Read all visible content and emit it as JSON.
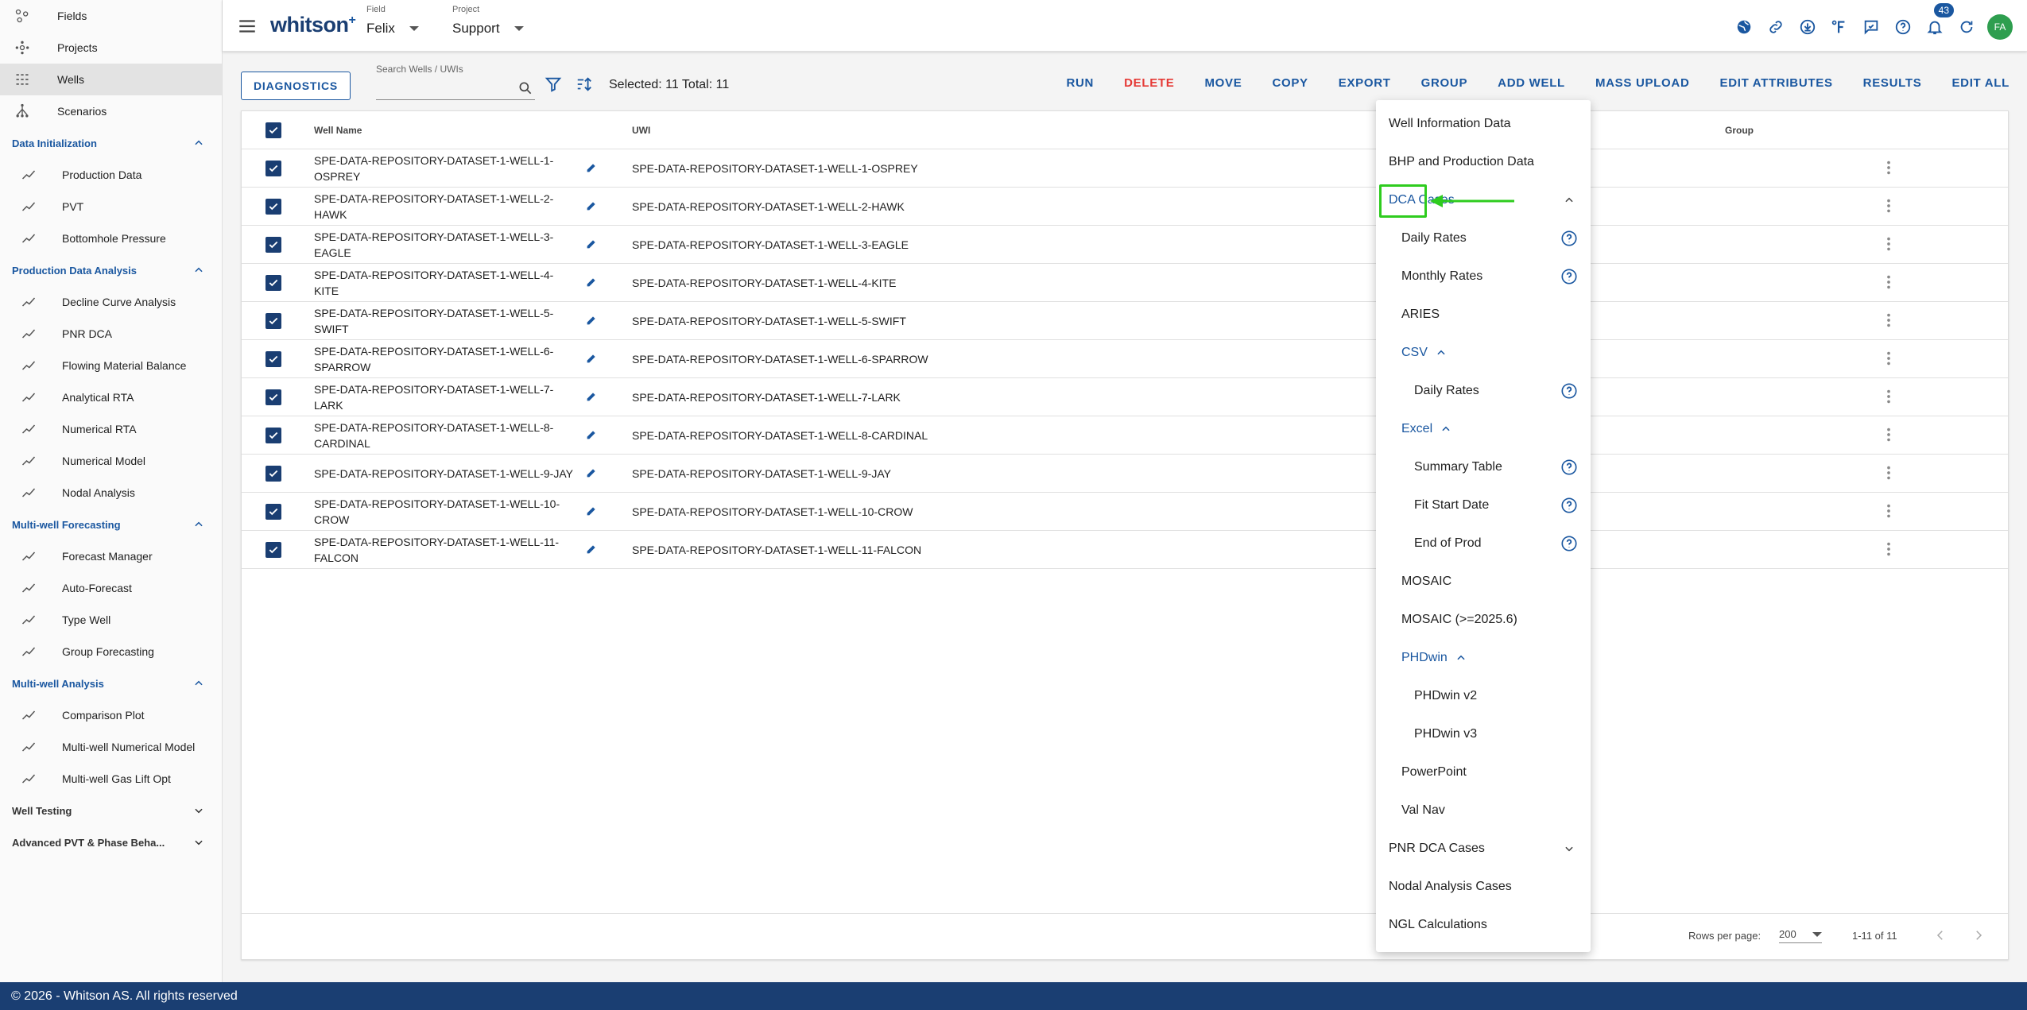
{
  "sidebar": {
    "top_items": [
      {
        "label": "Fields",
        "icon": "fields-icon"
      },
      {
        "label": "Projects",
        "icon": "projects-icon"
      },
      {
        "label": "Wells",
        "icon": "wells-icon"
      },
      {
        "label": "Scenarios",
        "icon": "scenarios-icon"
      }
    ],
    "sections": [
      {
        "title": "Data Initialization",
        "expanded": true,
        "items": [
          "Production Data",
          "PVT",
          "Bottomhole Pressure"
        ]
      },
      {
        "title": "Production Data Analysis",
        "expanded": true,
        "items": [
          "Decline Curve Analysis",
          "PNR DCA",
          "Flowing Material Balance",
          "Analytical RTA",
          "Numerical RTA",
          "Numerical Model",
          "Nodal Analysis"
        ]
      },
      {
        "title": "Multi-well Forecasting",
        "expanded": true,
        "items": [
          "Forecast Manager",
          "Auto-Forecast",
          "Type Well",
          "Group Forecasting"
        ]
      },
      {
        "title": "Multi-well Analysis",
        "expanded": true,
        "items": [
          "Comparison Plot",
          "Multi-well Numerical Model",
          "Multi-well Gas Lift Opt"
        ]
      },
      {
        "title": "Well Testing",
        "expanded": false,
        "items": []
      },
      {
        "title": "Advanced PVT & Phase Beha...",
        "expanded": false,
        "items": []
      }
    ]
  },
  "topbar": {
    "logo": "whitson",
    "logo_plus": "+",
    "field_label": "Field",
    "field_value": "Felix",
    "project_label": "Project",
    "project_value": "Support",
    "notifications_count": "43",
    "avatar_initials": "FA"
  },
  "toolbar": {
    "diagnostics_label": "DIAGNOSTICS",
    "search_placeholder": "Search Wells / UWIs",
    "selected_text": "Selected: 11 Total: 11",
    "actions": [
      "RUN",
      "DELETE",
      "MOVE",
      "COPY",
      "EXPORT",
      "GROUP",
      "ADD WELL",
      "MASS UPLOAD",
      "EDIT ATTRIBUTES",
      "RESULTS",
      "EDIT ALL"
    ]
  },
  "table": {
    "headers": {
      "well_name": "Well Name",
      "uwi": "UWI",
      "group": "Group"
    },
    "rows": [
      {
        "name": "SPE-DATA-REPOSITORY-DATASET-1-WELL-1-OSPREY",
        "uwi": "SPE-DATA-REPOSITORY-DATASET-1-WELL-1-OSPREY"
      },
      {
        "name": "SPE-DATA-REPOSITORY-DATASET-1-WELL-2-HAWK",
        "uwi": "SPE-DATA-REPOSITORY-DATASET-1-WELL-2-HAWK"
      },
      {
        "name": "SPE-DATA-REPOSITORY-DATASET-1-WELL-3-EAGLE",
        "uwi": "SPE-DATA-REPOSITORY-DATASET-1-WELL-3-EAGLE"
      },
      {
        "name": "SPE-DATA-REPOSITORY-DATASET-1-WELL-4-KITE",
        "uwi": "SPE-DATA-REPOSITORY-DATASET-1-WELL-4-KITE"
      },
      {
        "name": "SPE-DATA-REPOSITORY-DATASET-1-WELL-5-SWIFT",
        "uwi": "SPE-DATA-REPOSITORY-DATASET-1-WELL-5-SWIFT"
      },
      {
        "name": "SPE-DATA-REPOSITORY-DATASET-1-WELL-6-SPARROW",
        "uwi": "SPE-DATA-REPOSITORY-DATASET-1-WELL-6-SPARROW"
      },
      {
        "name": "SPE-DATA-REPOSITORY-DATASET-1-WELL-7-LARK",
        "uwi": "SPE-DATA-REPOSITORY-DATASET-1-WELL-7-LARK"
      },
      {
        "name": "SPE-DATA-REPOSITORY-DATASET-1-WELL-8-CARDINAL",
        "uwi": "SPE-DATA-REPOSITORY-DATASET-1-WELL-8-CARDINAL"
      },
      {
        "name": "SPE-DATA-REPOSITORY-DATASET-1-WELL-9-JAY",
        "uwi": "SPE-DATA-REPOSITORY-DATASET-1-WELL-9-JAY"
      },
      {
        "name": "SPE-DATA-REPOSITORY-DATASET-1-WELL-10-CROW",
        "uwi": "SPE-DATA-REPOSITORY-DATASET-1-WELL-10-CROW"
      },
      {
        "name": "SPE-DATA-REPOSITORY-DATASET-1-WELL-11-FALCON",
        "uwi": "SPE-DATA-REPOSITORY-DATASET-1-WELL-11-FALCON"
      }
    ],
    "footer": {
      "rows_per_page_label": "Rows per page:",
      "rows_per_page_value": "200",
      "range": "1-11 of 11"
    }
  },
  "export_menu": {
    "items": [
      {
        "label": "Well Information Data",
        "level": 0
      },
      {
        "label": "BHP and Production Data",
        "level": 0
      },
      {
        "label": "DCA Cases",
        "level": 0,
        "blue": true,
        "toggle": "up"
      },
      {
        "label": "Daily Rates",
        "level": 1,
        "help": true
      },
      {
        "label": "Monthly Rates",
        "level": 1,
        "help": true
      },
      {
        "label": "ARIES",
        "level": 1
      },
      {
        "label": "CSV",
        "level": 1,
        "blue": true,
        "inline_toggle": "up"
      },
      {
        "label": "Daily Rates",
        "level": 2,
        "help": true
      },
      {
        "label": "Excel",
        "level": 1,
        "blue": true,
        "inline_toggle": "up"
      },
      {
        "label": "Summary Table",
        "level": 2,
        "help": true
      },
      {
        "label": "Fit Start Date",
        "level": 2,
        "help": true
      },
      {
        "label": "End of Prod",
        "level": 2,
        "help": true
      },
      {
        "label": "MOSAIC",
        "level": 1
      },
      {
        "label": "MOSAIC (>=2025.6)",
        "level": 1
      },
      {
        "label": "PHDwin",
        "level": 1,
        "blue": true,
        "inline_toggle": "up"
      },
      {
        "label": "PHDwin v2",
        "level": 2
      },
      {
        "label": "PHDwin v3",
        "level": 2
      },
      {
        "label": "PowerPoint",
        "level": 1
      },
      {
        "label": "Val Nav",
        "level": 1
      },
      {
        "label": "PNR DCA Cases",
        "level": 0,
        "toggle": "down"
      },
      {
        "label": "Nodal Analysis Cases",
        "level": 0
      },
      {
        "label": "NGL Calculations",
        "level": 0
      }
    ]
  },
  "copyright": "© 2026 - Whitson AS. All rights reserved",
  "colors": {
    "brand": "#1a3e72",
    "accent": "#1a57a0",
    "danger": "#e53935",
    "highlight": "#2ecc1e"
  }
}
